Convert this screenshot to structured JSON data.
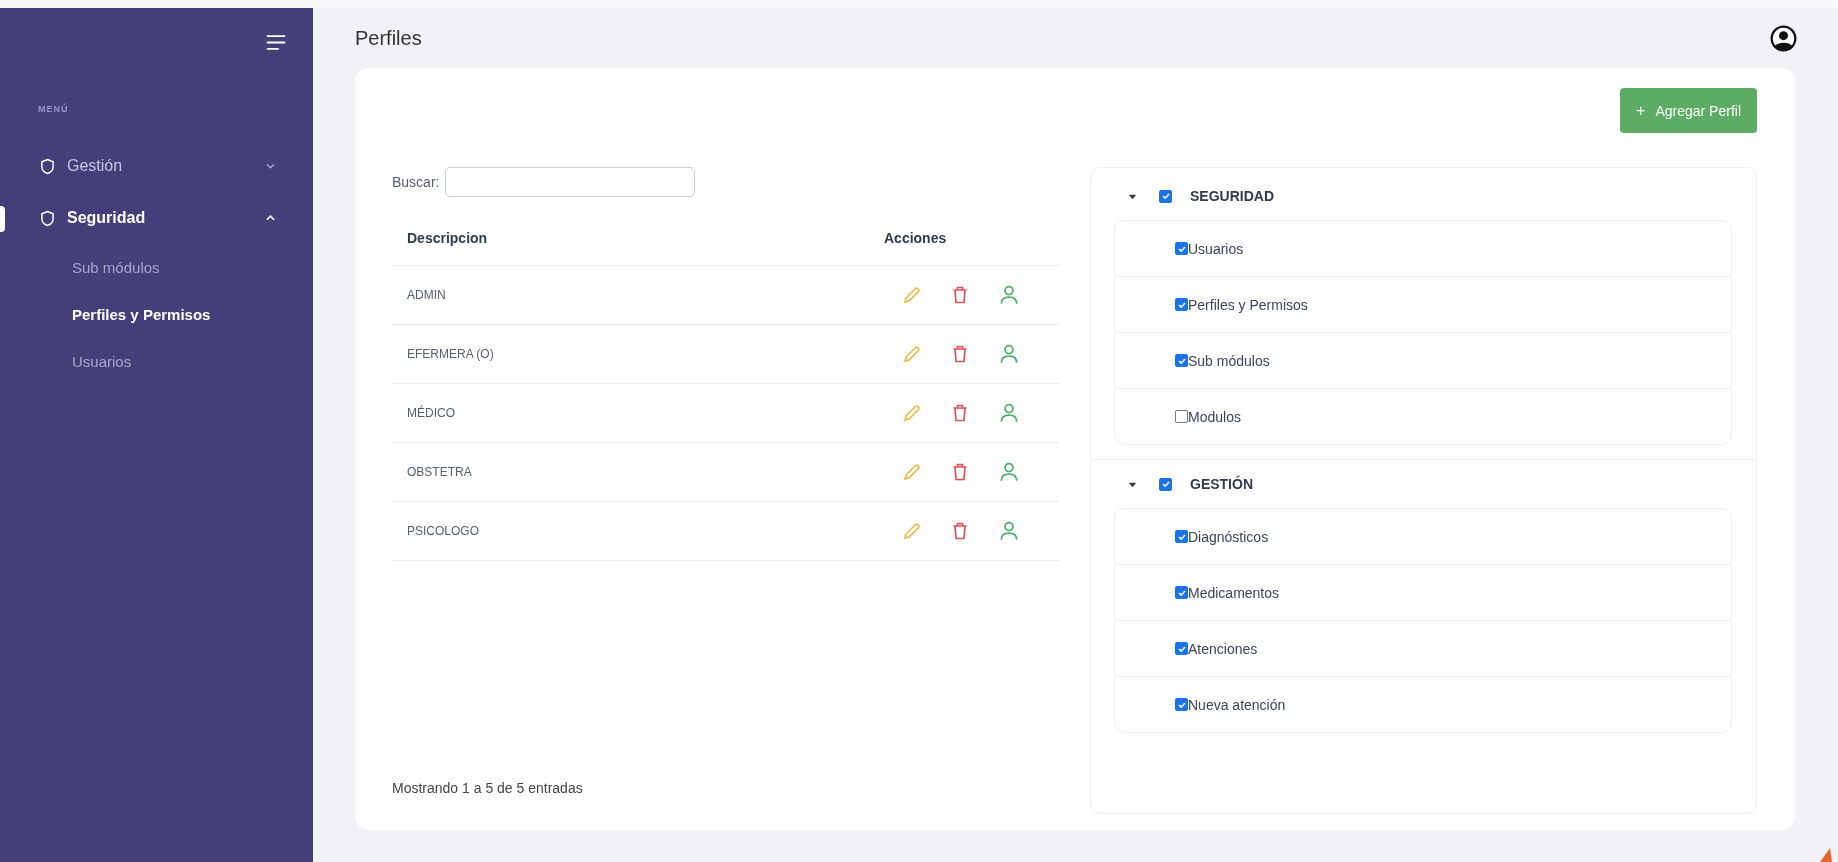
{
  "sidebar": {
    "menu_label": "MENÚ",
    "items": [
      {
        "label": "Gestión",
        "expanded": false,
        "selected": false
      },
      {
        "label": "Seguridad",
        "expanded": true,
        "selected": true,
        "children": [
          {
            "label": "Sub módulos",
            "selected": false
          },
          {
            "label": "Perfiles y Permisos",
            "selected": true
          },
          {
            "label": "Usuarios",
            "selected": false
          }
        ]
      }
    ]
  },
  "page_title": "Perfiles",
  "add_button": {
    "icon": "+",
    "label": "Agregar Perfil"
  },
  "search": {
    "label": "Buscar:"
  },
  "table": {
    "columns": [
      "Descripcion",
      "Acciones"
    ],
    "rows": [
      {
        "description": "ADMIN"
      },
      {
        "description": "EFERMERA (O)"
      },
      {
        "description": "MÉDICO"
      },
      {
        "description": "OBSTETRA"
      },
      {
        "description": "PSICOLOGO"
      }
    ]
  },
  "table_info": "Mostrando 1 a 5 de 5 entradas",
  "tree": [
    {
      "label": "SEGURIDAD",
      "checked": true,
      "expanded": true,
      "items": [
        {
          "label": "Usuarios",
          "checked": true
        },
        {
          "label": "Perfiles y Permisos",
          "checked": true
        },
        {
          "label": "Sub módulos",
          "checked": true
        },
        {
          "label": "Modulos",
          "checked": false
        }
      ]
    },
    {
      "label": "GESTIÓN",
      "checked": true,
      "expanded": true,
      "items": [
        {
          "label": "Diagnósticos",
          "checked": true
        },
        {
          "label": "Medicamentos",
          "checked": true
        },
        {
          "label": "Atenciones",
          "checked": true
        },
        {
          "label": "Nueva atención",
          "checked": true
        }
      ]
    }
  ]
}
